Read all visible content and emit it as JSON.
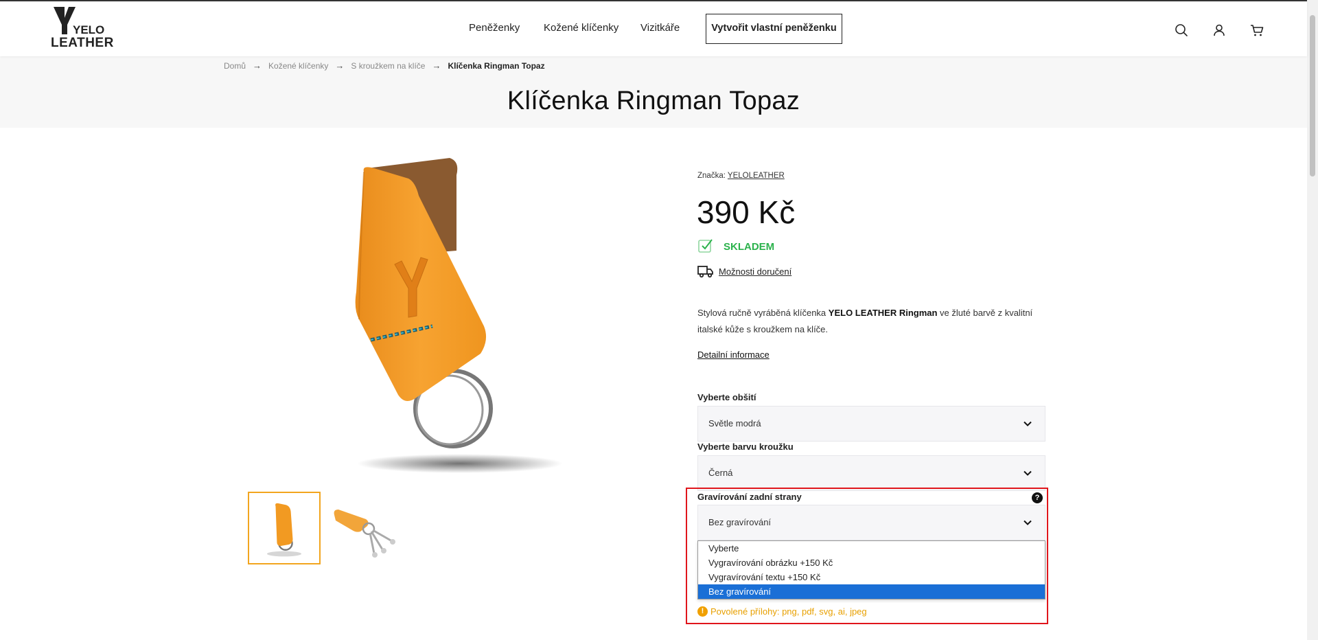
{
  "header": {
    "logo_line1": "YELO",
    "logo_line2": "LEATHER",
    "nav": [
      {
        "label": "Peněženky"
      },
      {
        "label": "Kožené klíčenky"
      },
      {
        "label": "Vizitkáře"
      }
    ],
    "cta_label": "Vytvořit vlastní peněženku",
    "icons": [
      "search-icon",
      "user-icon",
      "cart-icon"
    ]
  },
  "breadcrumb": {
    "items": [
      "Domů",
      "Kožené klíčenky",
      "S kroužkem na klíče",
      "Klíčenka Ringman Topaz"
    ],
    "separator": "→"
  },
  "page_title": "Klíčenka Ringman Topaz",
  "product": {
    "brand_label": "Značka:",
    "brand_name": "YELOLEATHER",
    "price": "390 Kč",
    "stock": "SKLADEM",
    "delivery_link": "Možnosti doručení",
    "desc_part1": "Stylová ručně vyráběná klíčenka ",
    "desc_bold": "YELO LEATHER Ringman",
    "desc_part2": " ve žluté barvě z kvalitní italské kůže s kroužkem na klíče.",
    "detail_link": "Detailní informace"
  },
  "options": {
    "stitching": {
      "label": "Vyberte obšití",
      "value": "Světle modrá"
    },
    "ring_color": {
      "label": "Vyberte barvu kroužku",
      "value": "Černá"
    },
    "engraving": {
      "label": "Gravírování zadní strany",
      "value": "Bez gravírování",
      "help": "?",
      "dropdown": [
        "Vyberte",
        "Vygravírování obrázku +150 Kč",
        "Vygravírování textu +150 Kč",
        "Bez gravírování"
      ]
    },
    "attachments_note": "Povolené přílohy: png, pdf, svg, ai, jpeg",
    "warn_glyph": "!"
  },
  "colors": {
    "accent": "#f2a51e",
    "stock_green": "#2bb24c",
    "highlight_red": "#e0151b",
    "selected_blue": "#1a6fd6",
    "warn_orange": "#e8a000"
  }
}
